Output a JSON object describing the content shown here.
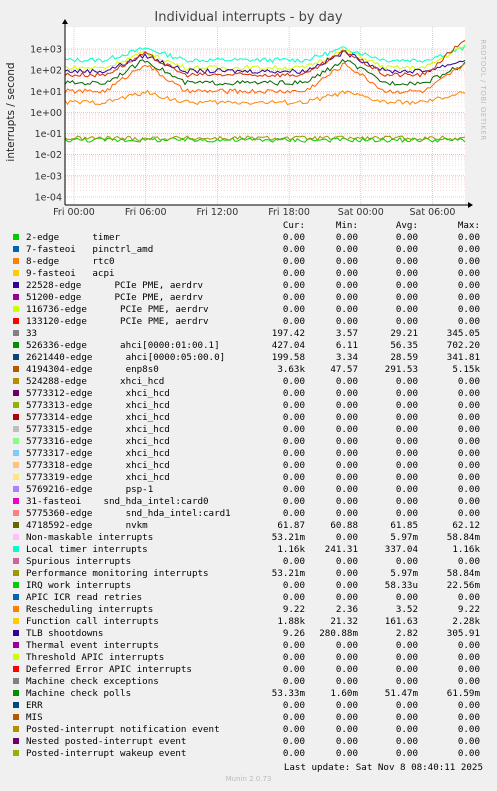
{
  "title": "Individual interrupts - by day",
  "ylabel": "interrupts / second",
  "side_label": "RRDTOOL / TOBI OETIKER",
  "chart_data": {
    "type": "line",
    "title": "Individual interrupts - by day",
    "ylabel": "interrupts / second",
    "yscale": "log",
    "ylim": [
      0.0001,
      3000
    ],
    "y_ticks": [
      "1e+03",
      "1e+02",
      "1e+01",
      "1e+00",
      "1e-01",
      "1e-02",
      "1e-03",
      "1e-04"
    ],
    "x_ticks": [
      "Fri 00:00",
      "Fri 06:00",
      "Fri 12:00",
      "Fri 18:00",
      "Sat 00:00",
      "Sat 06:00"
    ],
    "grid": true,
    "legend_placement": "below",
    "series": [
      {
        "name": "Local timer interrupts",
        "color": "#00ffcc",
        "levels": [
          300,
          300,
          1100,
          300,
          300,
          300,
          300,
          1100,
          300,
          300,
          1160
        ]
      },
      {
        "name": "Function call interrupts",
        "color": "#ccff00",
        "levels": [
          130,
          130,
          700,
          130,
          130,
          130,
          130,
          900,
          130,
          130,
          1500
        ]
      },
      {
        "name": "TLB shootdowns",
        "color": "#330099",
        "levels": [
          90,
          90,
          500,
          90,
          90,
          90,
          90,
          700,
          90,
          90,
          300
        ]
      },
      {
        "name": "4194304-edge",
        "color": "#cc3300",
        "levels": [
          60,
          60,
          600,
          60,
          60,
          60,
          60,
          800,
          60,
          60,
          3000
        ]
      },
      {
        "name": "33",
        "color": "#006600",
        "levels": [
          25,
          25,
          300,
          25,
          25,
          25,
          25,
          300,
          25,
          25,
          200
        ]
      },
      {
        "name": "2621440-edge",
        "color": "#ff6600",
        "levels": [
          10,
          10,
          200,
          10,
          10,
          10,
          10,
          200,
          10,
          10,
          200
        ]
      },
      {
        "name": "Rescheduling interrupts",
        "color": "#ff8800",
        "levels": [
          3,
          3,
          9,
          3,
          3,
          3,
          3,
          9,
          3,
          3,
          9
        ]
      },
      {
        "name": "Machine check polls",
        "color": "#00cc00",
        "levels": [
          0.05,
          0.05,
          0.05,
          0.05,
          0.05,
          0.05,
          0.05,
          0.05,
          0.05,
          0.05,
          0.05
        ]
      },
      {
        "name": "4718592-edge",
        "color": "#999900",
        "levels": [
          0.06,
          0.06,
          0.06,
          0.06,
          0.06,
          0.06,
          0.06,
          0.06,
          0.06,
          0.06,
          0.06
        ]
      }
    ],
    "columns": [
      "Cur:",
      "Min:",
      "Avg:",
      "Max:"
    ],
    "legend": [
      {
        "name": "2-edge      timer",
        "color": "#00cc00",
        "cur": "0.00",
        "min": "0.00",
        "avg": "0.00",
        "max": "0.00"
      },
      {
        "name": "7-fasteoi   pinctrl_amd",
        "color": "#0066b3",
        "cur": "0.00",
        "min": "0.00",
        "avg": "0.00",
        "max": "0.00"
      },
      {
        "name": "8-edge      rtc0",
        "color": "#ff8000",
        "cur": "0.00",
        "min": "0.00",
        "avg": "0.00",
        "max": "0.00"
      },
      {
        "name": "9-fasteoi   acpi",
        "color": "#ffcc00",
        "cur": "0.00",
        "min": "0.00",
        "avg": "0.00",
        "max": "0.00"
      },
      {
        "name": "22528-edge      PCIe PME, aerdrv",
        "color": "#330099",
        "cur": "0.00",
        "min": "0.00",
        "avg": "0.00",
        "max": "0.00"
      },
      {
        "name": "51200-edge      PCIe PME, aerdrv",
        "color": "#990099",
        "cur": "0.00",
        "min": "0.00",
        "avg": "0.00",
        "max": "0.00"
      },
      {
        "name": "116736-edge      PCIe PME, aerdrv",
        "color": "#ccff00",
        "cur": "0.00",
        "min": "0.00",
        "avg": "0.00",
        "max": "0.00"
      },
      {
        "name": "133120-edge      PCIe PME, aerdrv",
        "color": "#ff0000",
        "cur": "0.00",
        "min": "0.00",
        "avg": "0.00",
        "max": "0.00"
      },
      {
        "name": "33",
        "color": "#808080",
        "cur": "197.42",
        "min": "3.57",
        "avg": "29.21",
        "max": "345.05"
      },
      {
        "name": "526336-edge      ahci[0000:01:00.1]",
        "color": "#008f00",
        "cur": "427.04",
        "min": "6.11",
        "avg": "56.35",
        "max": "702.20"
      },
      {
        "name": "2621440-edge      ahci[0000:05:00.0]",
        "color": "#00487d",
        "cur": "199.58",
        "min": "3.34",
        "avg": "28.59",
        "max": "341.81"
      },
      {
        "name": "4194304-edge      enp8s0",
        "color": "#b35a00",
        "cur": "3.63k",
        "min": "47.57",
        "avg": "291.53",
        "max": "5.15k"
      },
      {
        "name": "524288-edge      xhci_hcd",
        "color": "#b38f00",
        "cur": "0.00",
        "min": "0.00",
        "avg": "0.00",
        "max": "0.00"
      },
      {
        "name": "5773312-edge      xhci_hcd",
        "color": "#6b006b",
        "cur": "0.00",
        "min": "0.00",
        "avg": "0.00",
        "max": "0.00"
      },
      {
        "name": "5773313-edge      xhci_hcd",
        "color": "#8fb300",
        "cur": "0.00",
        "min": "0.00",
        "avg": "0.00",
        "max": "0.00"
      },
      {
        "name": "5773314-edge      xhci_hcd",
        "color": "#b30000",
        "cur": "0.00",
        "min": "0.00",
        "avg": "0.00",
        "max": "0.00"
      },
      {
        "name": "5773315-edge      xhci_hcd",
        "color": "#bebebe",
        "cur": "0.00",
        "min": "0.00",
        "avg": "0.00",
        "max": "0.00"
      },
      {
        "name": "5773316-edge      xhci_hcd",
        "color": "#80ff80",
        "cur": "0.00",
        "min": "0.00",
        "avg": "0.00",
        "max": "0.00"
      },
      {
        "name": "5773317-edge      xhci_hcd",
        "color": "#80c9ff",
        "cur": "0.00",
        "min": "0.00",
        "avg": "0.00",
        "max": "0.00"
      },
      {
        "name": "5773318-edge      xhci_hcd",
        "color": "#ffc080",
        "cur": "0.00",
        "min": "0.00",
        "avg": "0.00",
        "max": "0.00"
      },
      {
        "name": "5773319-edge      xhci_hcd",
        "color": "#ffe680",
        "cur": "0.00",
        "min": "0.00",
        "avg": "0.00",
        "max": "0.00"
      },
      {
        "name": "5769216-edge      psp-1",
        "color": "#aa80ff",
        "cur": "0.00",
        "min": "0.00",
        "avg": "0.00",
        "max": "0.00"
      },
      {
        "name": "31-fasteoi    snd_hda_intel:card0",
        "color": "#ee00cc",
        "cur": "0.00",
        "min": "0.00",
        "avg": "0.00",
        "max": "0.00"
      },
      {
        "name": "5775360-edge      snd_hda_intel:card1",
        "color": "#ff8080",
        "cur": "0.00",
        "min": "0.00",
        "avg": "0.00",
        "max": "0.00"
      },
      {
        "name": "4718592-edge      nvkm",
        "color": "#666600",
        "cur": "61.87",
        "min": "60.88",
        "avg": "61.85",
        "max": "62.12"
      },
      {
        "name": "Non-maskable interrupts",
        "color": "#ffbfff",
        "cur": "53.21m",
        "min": "0.00",
        "avg": "5.97m",
        "max": "58.84m"
      },
      {
        "name": "Local timer interrupts",
        "color": "#00ffcc",
        "cur": "1.16k",
        "min": "241.31",
        "avg": "337.04",
        "max": "1.16k"
      },
      {
        "name": "Spurious interrupts",
        "color": "#cc6699",
        "cur": "0.00",
        "min": "0.00",
        "avg": "0.00",
        "max": "0.00"
      },
      {
        "name": "Performance monitoring interrupts",
        "color": "#999900",
        "cur": "53.21m",
        "min": "0.00",
        "avg": "5.97m",
        "max": "58.84m"
      },
      {
        "name": "IRQ work interrupts",
        "color": "#00cc00",
        "cur": "0.00",
        "min": "0.00",
        "avg": "58.33u",
        "max": "22.56m"
      },
      {
        "name": "APIC ICR read retries",
        "color": "#0066b3",
        "cur": "0.00",
        "min": "0.00",
        "avg": "0.00",
        "max": "0.00"
      },
      {
        "name": "Rescheduling interrupts",
        "color": "#ff8000",
        "cur": "9.22",
        "min": "2.36",
        "avg": "3.52",
        "max": "9.22"
      },
      {
        "name": "Function call interrupts",
        "color": "#ffcc00",
        "cur": "1.88k",
        "min": "21.32",
        "avg": "161.63",
        "max": "2.28k"
      },
      {
        "name": "TLB shootdowns",
        "color": "#330099",
        "cur": "9.26",
        "min": "280.88m",
        "avg": "2.82",
        "max": "305.91"
      },
      {
        "name": "Thermal event interrupts",
        "color": "#990099",
        "cur": "0.00",
        "min": "0.00",
        "avg": "0.00",
        "max": "0.00"
      },
      {
        "name": "Threshold APIC interrupts",
        "color": "#ccff00",
        "cur": "0.00",
        "min": "0.00",
        "avg": "0.00",
        "max": "0.00"
      },
      {
        "name": "Deferred Error APIC interrupts",
        "color": "#ff0000",
        "cur": "0.00",
        "min": "0.00",
        "avg": "0.00",
        "max": "0.00"
      },
      {
        "name": "Machine check exceptions",
        "color": "#808080",
        "cur": "0.00",
        "min": "0.00",
        "avg": "0.00",
        "max": "0.00"
      },
      {
        "name": "Machine check polls",
        "color": "#008f00",
        "cur": "53.33m",
        "min": "1.60m",
        "avg": "51.47m",
        "max": "61.59m"
      },
      {
        "name": "ERR",
        "color": "#00487d",
        "cur": "0.00",
        "min": "0.00",
        "avg": "0.00",
        "max": "0.00"
      },
      {
        "name": "MIS",
        "color": "#b35a00",
        "cur": "0.00",
        "min": "0.00",
        "avg": "0.00",
        "max": "0.00"
      },
      {
        "name": "Posted-interrupt notification event",
        "color": "#b38f00",
        "cur": "0.00",
        "min": "0.00",
        "avg": "0.00",
        "max": "0.00"
      },
      {
        "name": "Nested posted-interrupt event",
        "color": "#6b006b",
        "cur": "0.00",
        "min": "0.00",
        "avg": "0.00",
        "max": "0.00"
      },
      {
        "name": "Posted-interrupt wakeup event",
        "color": "#8fb300",
        "cur": "0.00",
        "min": "0.00",
        "avg": "0.00",
        "max": "0.00"
      }
    ]
  },
  "footer": {
    "last_update": "Last update: Sat Nov  8 08:40:11 2025",
    "munin": "Munin 2.0.73"
  }
}
